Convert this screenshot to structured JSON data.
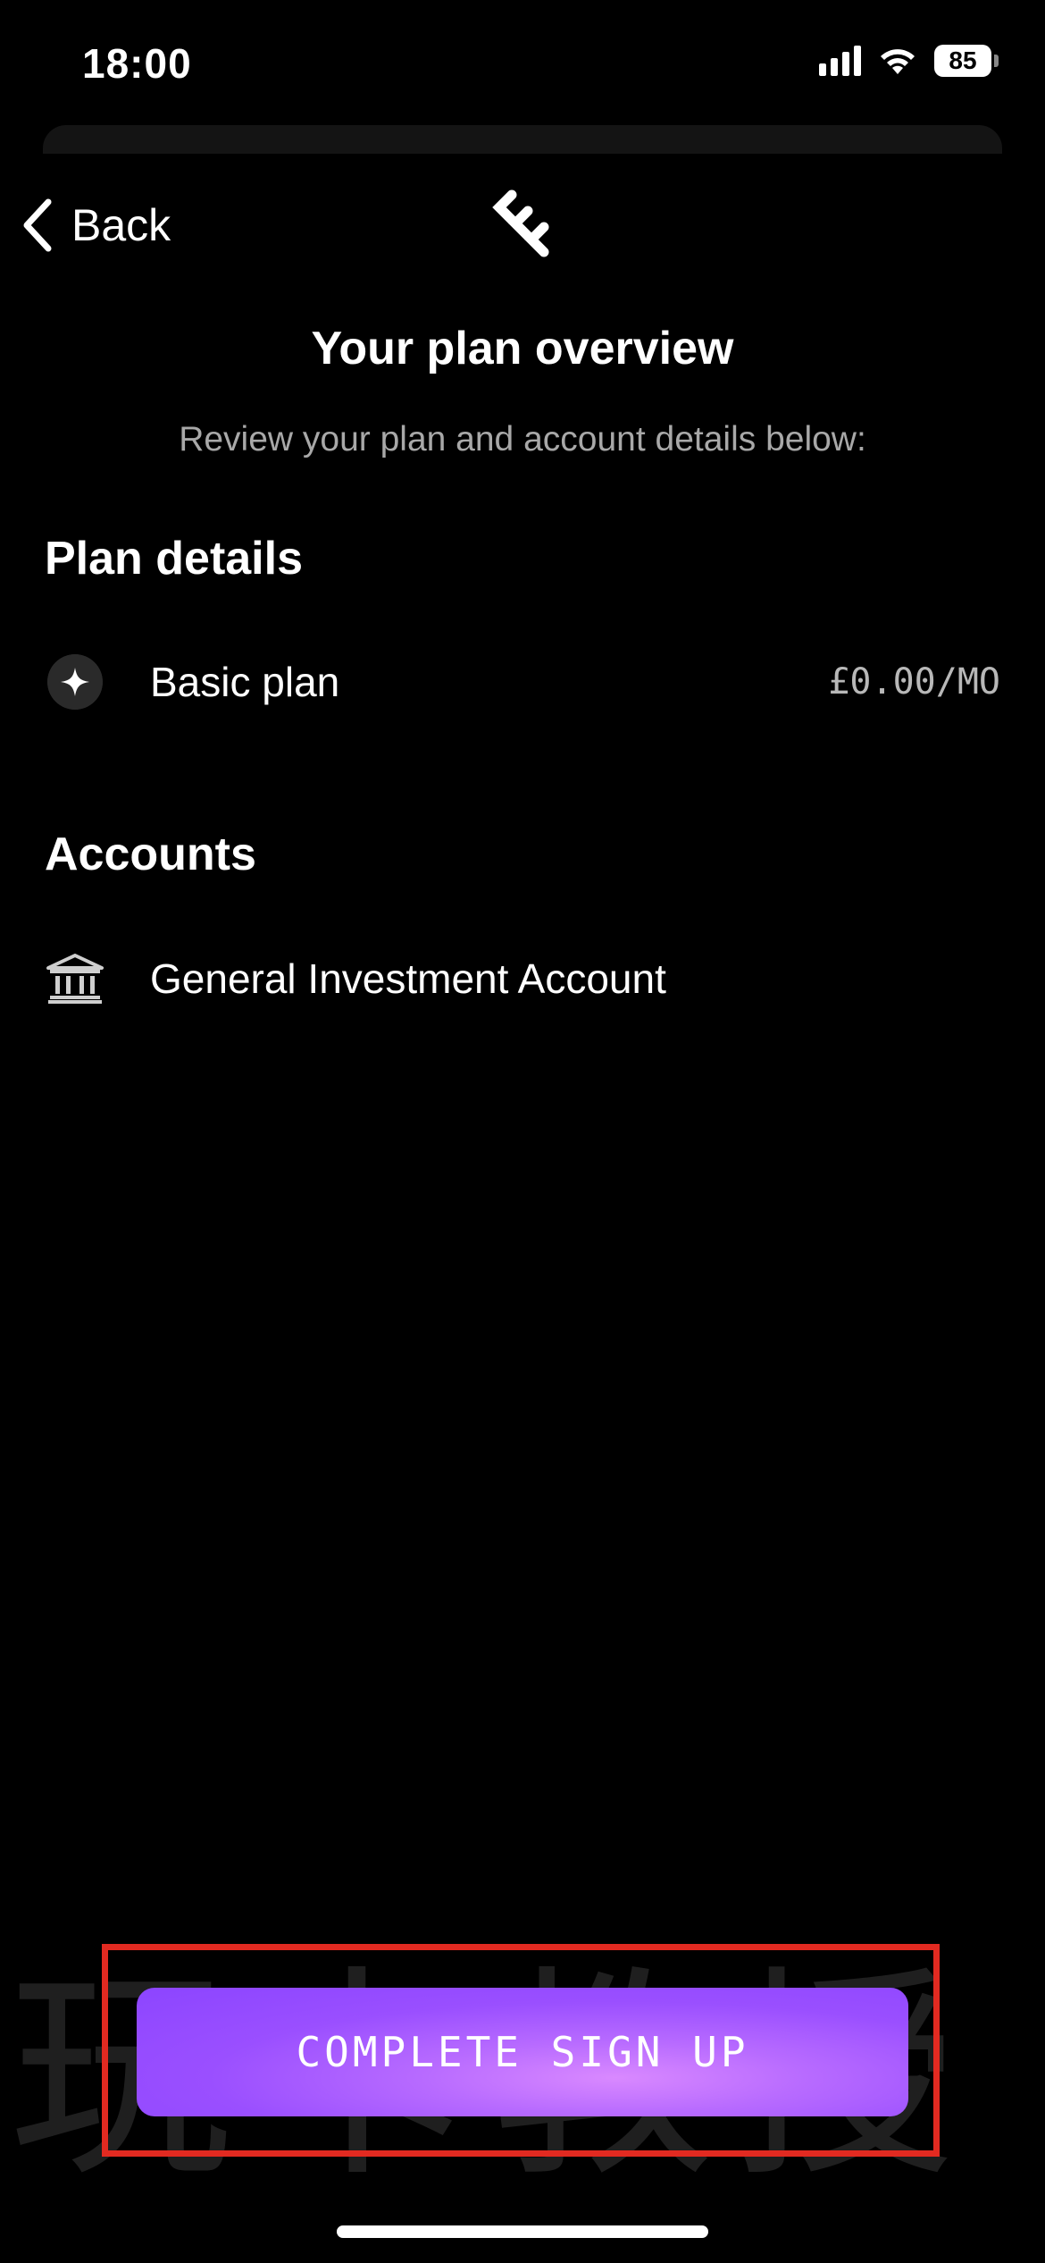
{
  "status_bar": {
    "time": "18:00",
    "battery": "85"
  },
  "nav": {
    "back_label": "Back"
  },
  "header": {
    "title": "Your plan overview",
    "subtitle": "Review your plan and account details below:"
  },
  "plan_section": {
    "heading": "Plan details",
    "items": [
      {
        "icon": "sparkle-icon",
        "label": "Basic plan",
        "price": "£0.00/MO"
      }
    ]
  },
  "accounts_section": {
    "heading": "Accounts",
    "items": [
      {
        "icon": "bank-icon",
        "label": "General Investment Account"
      }
    ]
  },
  "cta": {
    "label": "COMPLETE SIGN UP"
  },
  "watermark": {
    "text": "玩卡教授"
  },
  "colors": {
    "background": "#000000",
    "cta_gradient_start": "#8c45ff",
    "cta_gradient_glow": "#d989ff",
    "highlight_box": "#e22a21",
    "muted_text": "#a8a8a8"
  }
}
